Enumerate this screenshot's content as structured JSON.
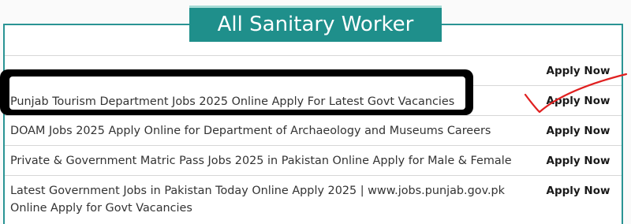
{
  "section": {
    "title": "All Sanitary Worker"
  },
  "jobs": [
    {
      "title": "",
      "action": "Apply Now"
    },
    {
      "title": "Punjab Tourism Department Jobs 2025 Online Apply For Latest Govt Vacancies",
      "action": "Apply Now"
    },
    {
      "title": "DOAM Jobs 2025 Apply Online for Department of Archaeology and Museums Careers",
      "action": "Apply Now"
    },
    {
      "title": "Private & Government Matric Pass Jobs 2025 in Pakistan Online Apply for Male & Female",
      "action": "Apply Now"
    },
    {
      "title": "Latest Government Jobs in Pakistan Today Online Apply 2025 | www.jobs.punjab.gov.pk Online Apply for Govt Vacancies",
      "action": "Apply Now"
    }
  ],
  "colors": {
    "accent": "#1f8f8b",
    "border": "#2a9494",
    "redaction": "#000000",
    "checkmark": "#e02020"
  },
  "annotations": [
    "redaction-marker",
    "check-mark"
  ]
}
